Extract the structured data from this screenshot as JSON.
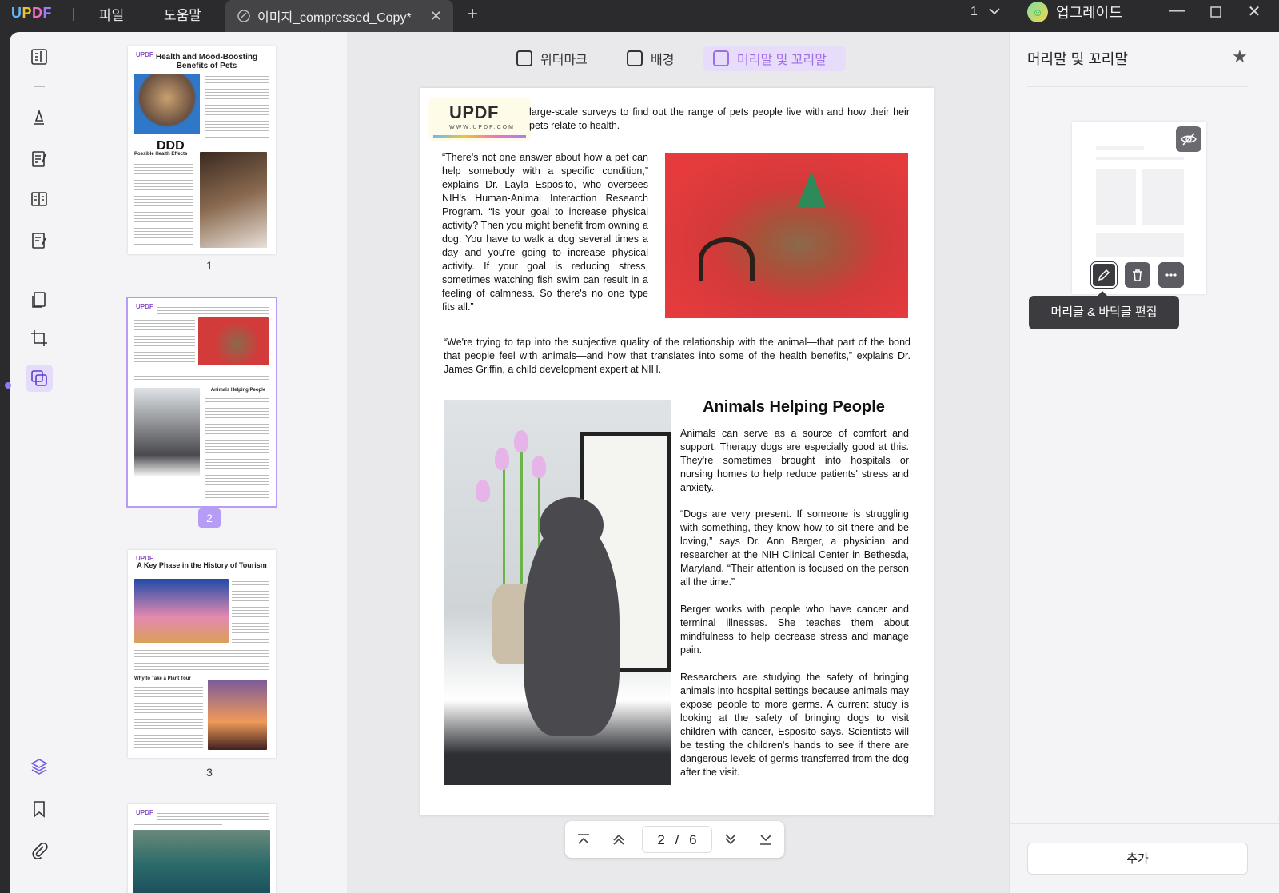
{
  "app": {
    "logo": "UPDF",
    "menu": [
      "파일",
      "도움말"
    ],
    "tab_title": "이미지_compressed_Copy*",
    "page_selector": "1",
    "upgrade_label": "업그레이드"
  },
  "main_toolbar": {
    "watermark": "워터마크",
    "background": "배경",
    "header_footer": "머리말 및 꼬리말"
  },
  "thumbnails": [
    {
      "number": "1",
      "title": "Health and Mood-Boosting Benefits of Pets",
      "label": "DDD",
      "sub": "Possible Health Effects"
    },
    {
      "number": "2",
      "title": "",
      "sub": "Animals Helping People"
    },
    {
      "number": "3",
      "title": "A Key Phase in the History of Tourism",
      "sub": "Why to Take a Plant Tour"
    },
    {
      "number": "",
      "title": ""
    }
  ],
  "document": {
    "watermark_logo": "UPDF",
    "watermark_small": "WWW.UPDF.COM",
    "intro": "large-scale surveys to find out the range of pets people live with and how their heir pets relate to health.",
    "quote1": "“There's not one answer about how a pet can help somebody with a specific condition,” explains Dr. Layla Esposito, who oversees NIH's Human-Animal Interaction Research Program. “Is your goal to increase physical activity? Then you might benefit from owning a dog. You have to walk a dog several times a day and you're going to increase physical activity. If your goal is reducing stress, sometimes watching fish swim can result in a feeling of calmness. So there's no one type fits all.”",
    "quote2": "“We're trying to tap into the subjective quality of the relationship with the animal—that part of the bond that people feel with animals—and how that translates into some of the health benefits,” explains Dr. James Griffin, a child development expert at NIH.",
    "section_heading": "Animals Helping People",
    "para1": "Animals can serve as a source of comfort and support. Therapy dogs are especially good at this. They're sometimes brought into hospitals or nursing homes to help reduce patients' stress and anxiety.",
    "para2": "“Dogs are very present. If someone is struggling with something, they know how to sit there and be loving,” says Dr. Ann Berger, a physician and researcher at the NIH Clinical Center in Bethesda, Maryland. “Their attention is focused on the person all the time.”",
    "para3": "Berger works with people who have cancer and terminal illnesses. She teaches them about mindfulness to help decrease stress and manage pain.",
    "para4": "Researchers are studying the safety of bringing animals into hospital settings because animals may expose people to more germs. A current study is looking at the safety of bringing dogs to visit children with cancer, Esposito says. Scientists will be testing the children's hands to see if there are dangerous levels of germs transferred from the dog after the visit."
  },
  "pagination": {
    "current": "2",
    "separator": "/",
    "total": "6"
  },
  "right_panel": {
    "title": "머리말 및 꼬리말",
    "tooltip": "머리글 & 바닥글 편집",
    "add_button": "추가"
  },
  "colors": {
    "accent": "#b79cf5",
    "accent_text": "#a06de8",
    "titlebar": "#2b2b2e"
  }
}
